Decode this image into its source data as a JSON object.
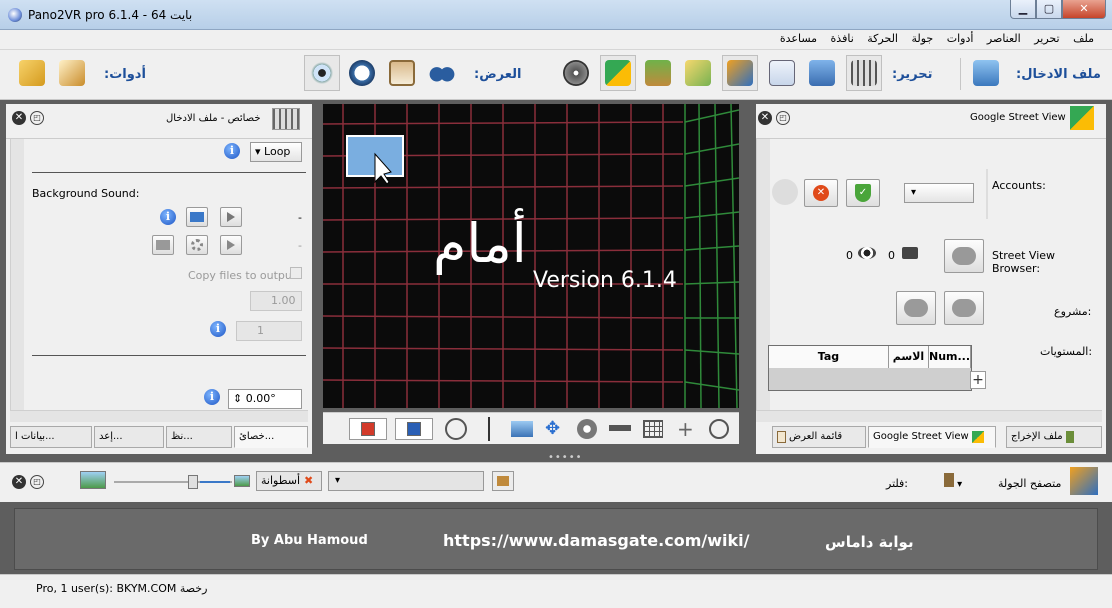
{
  "window": {
    "title": "Pano2VR pro 6.1.4 - بايت 64"
  },
  "menu": [
    "ملف",
    "تحرير",
    "العناصر",
    "أدوات",
    "جولة",
    "الحركة",
    "نافذة",
    "مساعدة"
  ],
  "toolbar": {
    "input_label": "ملف الادخال:",
    "edit_label": "تحرير:",
    "view_label": "العرض:",
    "tools_label": "أدوات:"
  },
  "left_panel": {
    "title": "خصائص - ملف الادخال",
    "loop_value": "Loop",
    "background_sound_label": "Background Sound:",
    "dash1": "-",
    "dash2": "-",
    "copy_files_label": "Copy files to output",
    "level_value": "1.00",
    "count_value": "1",
    "angle_value": "0.00°",
    "tabs": [
      "خصائ...",
      "نظ...",
      "إعد...",
      "بيانات ا..."
    ]
  },
  "center": {
    "title_text": "أمام",
    "version_text": "Version 6.1.4"
  },
  "right_panel": {
    "title": "Google Street View",
    "accounts_label": "Accounts:",
    "views_count": "0",
    "photos_count": "0",
    "street_view_browser_label": "Street View Browser:",
    "project_label": "مشروع:",
    "levels_label": "المستويات:",
    "table_headers": [
      "Tag",
      "الاسم",
      "Num..."
    ],
    "tabs": [
      "قائمة العرض",
      "Google Street View",
      "ملف الإخراج"
    ]
  },
  "bottom": {
    "filter_tag": "أسطوانة",
    "filter_label": "فلتر:",
    "tour_browser_label": "متصفح الجولة"
  },
  "banner": {
    "author": "By Abu Hamoud",
    "url": "https://www.damasgate.com/wiki/",
    "site_name": "بوابة داماس"
  },
  "status": {
    "license_text": "Pro, 1 user(s): BKYM.COM رخصة"
  },
  "colors": {
    "accent_blue": "#1d4f9a",
    "grid_red": "#8a2e3b",
    "grid_green": "#2f8a3a"
  }
}
